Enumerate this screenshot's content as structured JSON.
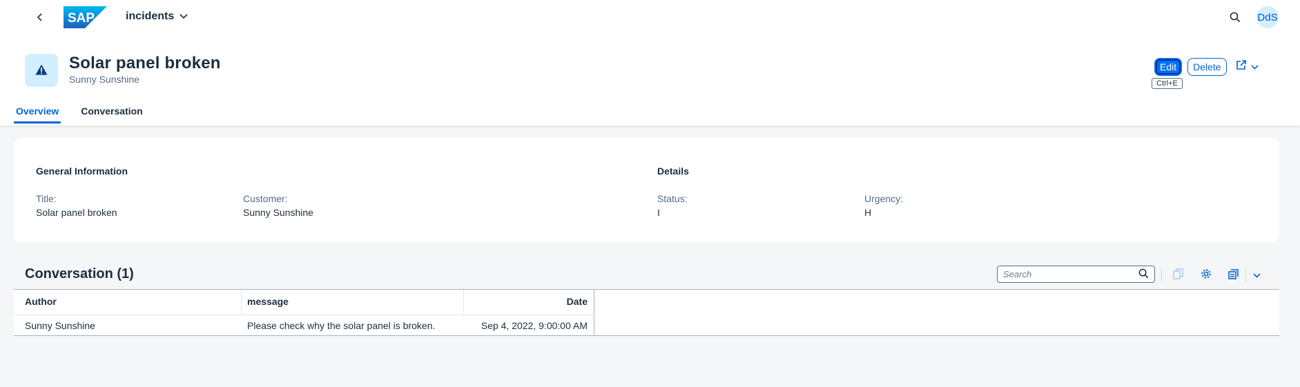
{
  "shell": {
    "app_title": "incidents",
    "logo_text": "SAP",
    "avatar_initials": "DdS"
  },
  "header": {
    "title": "Solar panel broken",
    "subtitle": "Sunny Sunshine",
    "edit_label": "Edit",
    "delete_label": "Delete",
    "edit_tooltip": "Ctrl+E"
  },
  "tabs": [
    {
      "label": "Overview",
      "active": true
    },
    {
      "label": "Conversation",
      "active": false
    }
  ],
  "general_info": {
    "title": "General Information",
    "fields": [
      {
        "label": "Title:",
        "value": "Solar panel broken"
      },
      {
        "label": "Customer:",
        "value": "Sunny Sunshine"
      }
    ]
  },
  "details": {
    "title": "Details",
    "fields": [
      {
        "label": "Status:",
        "value": "I"
      },
      {
        "label": "Urgency:",
        "value": "H"
      }
    ]
  },
  "conversation_table": {
    "title": "Conversation (1)",
    "search_placeholder": "Search",
    "columns": [
      "Author",
      "message",
      "Date"
    ],
    "rows": [
      [
        "Sunny Sunshine",
        "Please check why the solar panel is broken.",
        "Sep 4, 2022, 9:00:00 AM"
      ]
    ]
  },
  "colors": {
    "accent": "#0064d9",
    "primary_button": "#0070f2",
    "icon_bg": "#d1efff",
    "text": "#1d2d3e"
  },
  "icons": [
    "back-icon",
    "sap-logo",
    "chevron-down-icon",
    "search-icon",
    "warning-icon",
    "share-icon",
    "copy-icon",
    "settings-icon",
    "export-icon"
  ]
}
